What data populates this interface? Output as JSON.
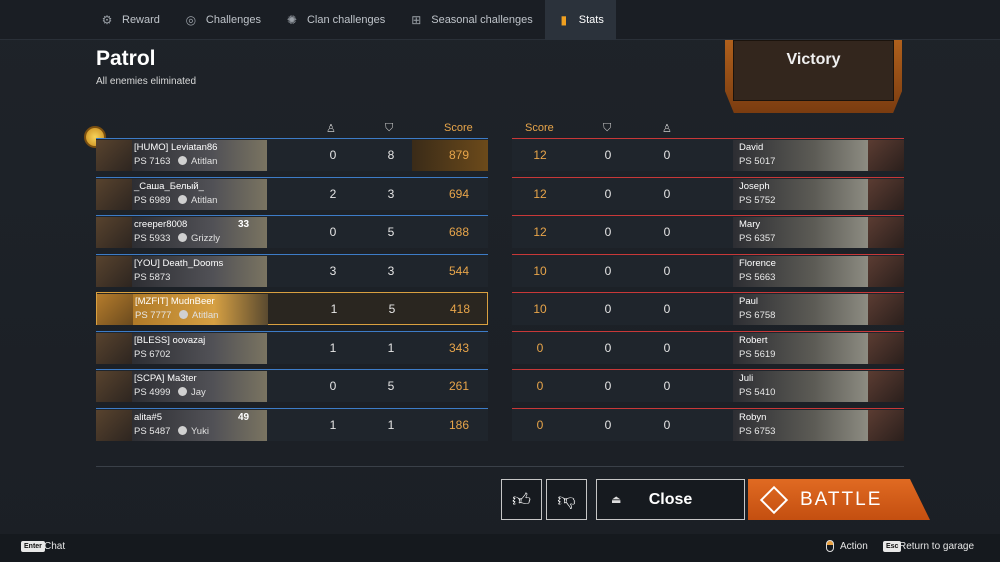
{
  "tabs": [
    {
      "label": "Reward",
      "icon": "reward-icon",
      "glyph": "⚙"
    },
    {
      "label": "Challenges",
      "icon": "challenges-icon",
      "glyph": "◎"
    },
    {
      "label": "Clan challenges",
      "icon": "clan-challenges-icon",
      "glyph": "✺"
    },
    {
      "label": "Seasonal challenges",
      "icon": "seasonal-challenges-icon",
      "glyph": "⊞"
    },
    {
      "label": "Stats",
      "icon": "stats-icon",
      "glyph": "▮"
    }
  ],
  "mode": "Patrol",
  "result_text": "All enemies eliminated",
  "outcome": "Victory",
  "headers": {
    "score": "Score"
  },
  "team_left": [
    {
      "name": "[HUMO] Leviatan86",
      "ps": "PS 7163",
      "clan": "Atitlan",
      "kills": "0",
      "assists": "8",
      "score": "879"
    },
    {
      "name": "_Саша_Белый_",
      "ps": "PS 6989",
      "clan": "Atitlan",
      "kills": "2",
      "assists": "3",
      "score": "694"
    },
    {
      "name": "creeper8008",
      "ps": "PS 5933",
      "clan": "Grizzly",
      "level": "33",
      "kills": "0",
      "assists": "5",
      "score": "688"
    },
    {
      "name": "[YOU] Death_Dooms",
      "ps": "PS 5873",
      "clan": "",
      "kills": "3",
      "assists": "3",
      "score": "544"
    },
    {
      "name": "[MZFIT] MudnBeer",
      "ps": "PS 7777",
      "clan": "Atitlan",
      "kills": "1",
      "assists": "5",
      "score": "418"
    },
    {
      "name": "[BLESS] oovazaj",
      "ps": "PS 6702",
      "clan": "",
      "kills": "1",
      "assists": "1",
      "score": "343"
    },
    {
      "name": "[SCPA] Ma3ter",
      "ps": "PS 4999",
      "clan": "Jay",
      "kills": "0",
      "assists": "5",
      "score": "261"
    },
    {
      "name": "alita#5",
      "ps": "PS 5487",
      "clan": "Yuki",
      "level": "49",
      "kills": "1",
      "assists": "1",
      "score": "186"
    }
  ],
  "team_right": [
    {
      "name": "David",
      "ps": "PS 5017",
      "score": "12",
      "kills": "0",
      "assists": "0"
    },
    {
      "name": "Joseph",
      "ps": "PS 5752",
      "score": "12",
      "kills": "0",
      "assists": "0"
    },
    {
      "name": "Mary",
      "ps": "PS 6357",
      "score": "12",
      "kills": "0",
      "assists": "0"
    },
    {
      "name": "Florence",
      "ps": "PS 5663",
      "score": "10",
      "kills": "0",
      "assists": "0"
    },
    {
      "name": "Paul",
      "ps": "PS 6758",
      "score": "10",
      "kills": "0",
      "assists": "0"
    },
    {
      "name": "Robert",
      "ps": "PS 5619",
      "score": "0",
      "kills": "0",
      "assists": "0"
    },
    {
      "name": "Juli",
      "ps": "PS 5410",
      "score": "0",
      "kills": "0",
      "assists": "0"
    },
    {
      "name": "Robyn",
      "ps": "PS 6753",
      "score": "0",
      "kills": "0",
      "assists": "0"
    }
  ],
  "buttons": {
    "close": "Close",
    "battle": "BATTLE"
  },
  "footer": {
    "chat_key": "Enter",
    "chat": "Chat",
    "action": "Action",
    "esc_key": "Esc",
    "return": "Return to garage"
  },
  "colors": {
    "accent": "#e06a22",
    "ally": "#3d7cc7",
    "enemy": "#c83838",
    "score": "#e8a54a"
  }
}
